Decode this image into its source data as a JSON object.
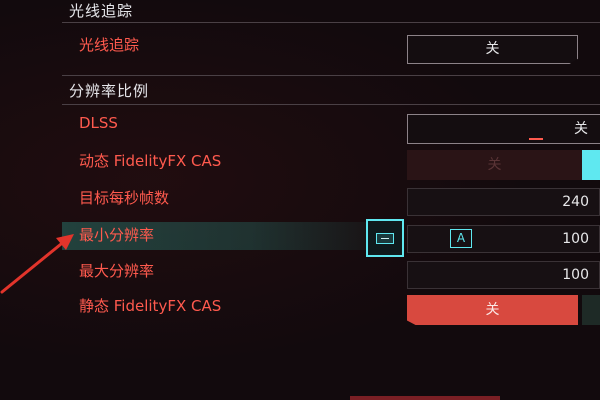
{
  "sections": {
    "ray_tracing_title": "光线追踪",
    "resolution_scaling_title": "分辨率比例"
  },
  "settings": {
    "ray_tracing": {
      "label": "光线追踪",
      "value": "关"
    },
    "dlss": {
      "label": "DLSS",
      "value": "关"
    },
    "dynamic_cas": {
      "label": "动态 FidelityFX CAS",
      "value": "关"
    },
    "target_fps": {
      "label": "目标每秒帧数",
      "value": "240"
    },
    "min_resolution": {
      "label": "最小分辨率",
      "value": "100",
      "badge": "A"
    },
    "max_resolution": {
      "label": "最大分辨率",
      "value": "100"
    },
    "static_cas": {
      "label": "静态 FidelityFX CAS",
      "value": "关"
    }
  },
  "icons": {
    "decrement": "minus-button-icon",
    "annotation": "red-arrow-icon"
  },
  "colors": {
    "background": "#120a0d",
    "label_red": "#ff5a4e",
    "accent_cyan": "#5fe8f0",
    "toggle_red": "#d8493f",
    "text_light": "#e8e8ea"
  }
}
